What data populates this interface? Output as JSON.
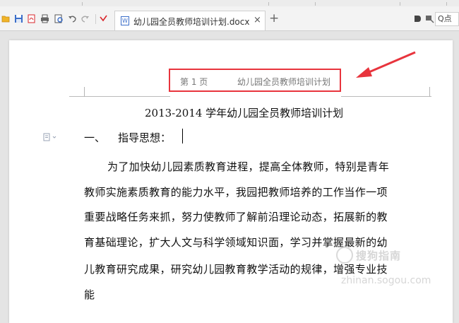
{
  "toolbar": {
    "icons": [
      "open-icon",
      "save-icon",
      "export-pdf-icon",
      "print-icon",
      "print-preview-icon",
      "undo-icon",
      "redo-icon",
      "more-icon",
      "wps-logo"
    ],
    "wps_glyph": "W",
    "tab": {
      "label": "幼儿园全员教师培训计划.docx",
      "close_glyph": "×",
      "icon_glyph": "W"
    },
    "new_tab_glyph": "+",
    "search_glyph": "Q点"
  },
  "document": {
    "header": {
      "page_label": "第 1 页",
      "title": "幼儿园全员教师培训计划"
    },
    "title": "2013-2014 学年幼儿园全员教师培训计划",
    "section": {
      "number": "一、",
      "heading": "指导思想："
    },
    "paragraph_lines": [
      "为了加快幼儿园素质教育进程，提高全体教师，特别是青年",
      "教师实施素质教育的能力水平，我园把教师培养的工作当作一项",
      "重要战略任务来抓，努力使教师了解前沿理论动态，拓展新的教",
      "育基础理论，扩大人文与科学领域知识面，学习并掌握最新的幼",
      "儿教育研究成果，研究幼儿园教育教学活动的规律，增强专业技",
      "能"
    ]
  },
  "watermark": {
    "name": "搜狗指南",
    "url": "zhinan.sogou.com"
  },
  "colors": {
    "highlight": "#e8343d",
    "arrow": "#e8343d",
    "wps_red": "#d9252b",
    "accent_blue": "#3b6ec9"
  }
}
